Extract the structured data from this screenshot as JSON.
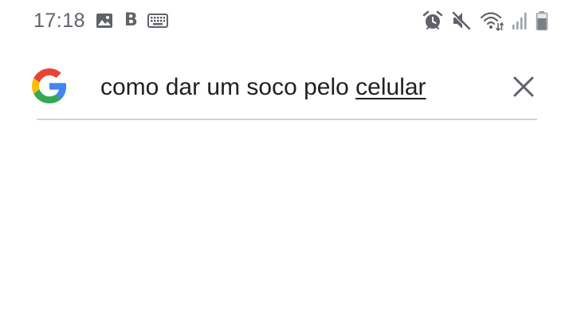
{
  "status_bar": {
    "time": "17:18",
    "left_icons": [
      "image-icon",
      "b-letter-icon",
      "keyboard-icon"
    ],
    "b_letter": "B",
    "right_icons": [
      "alarm-icon",
      "mute-icon",
      "wifi-icon",
      "signal-icon",
      "battery-icon"
    ]
  },
  "search": {
    "query_plain": "como dar um soco pelo ",
    "query_underlined": "celular",
    "clear_icon": "close-icon"
  },
  "colors": {
    "icon_gray": "#5f6368",
    "text": "#202124",
    "divider": "#d3d3d3",
    "google_blue": "#4285F4",
    "google_red": "#EA4335",
    "google_yellow": "#FBBC05",
    "google_green": "#34A853"
  }
}
